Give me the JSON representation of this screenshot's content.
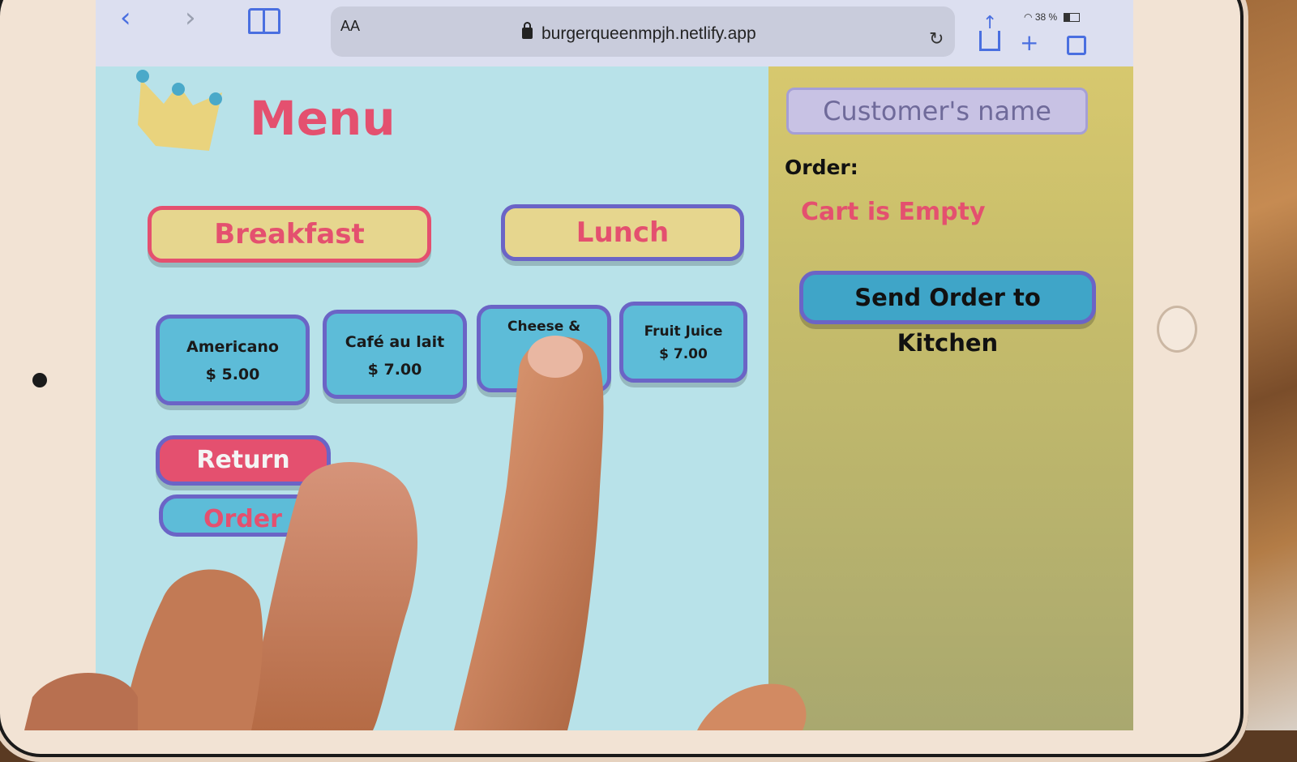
{
  "browser": {
    "text_size_label": "AA",
    "url": "burgerqueenmpjh.netlify.app",
    "battery_text": "38 %"
  },
  "menu": {
    "title": "Menu",
    "tabs": [
      {
        "label": "Breakfast"
      },
      {
        "label": "Lunch"
      }
    ],
    "items": [
      {
        "name": "Americano",
        "price": "$ 5.00"
      },
      {
        "name": "Café au lait",
        "price": "$ 7.00"
      },
      {
        "name": "Cheese &",
        "price": ""
      },
      {
        "name": "Fruit Juice",
        "price": "$ 7.00"
      }
    ],
    "return_label": "Return",
    "orders_label": "Order"
  },
  "order": {
    "customer_placeholder": "Customer's name",
    "order_label": "Order:",
    "cart_status": "Cart is Empty",
    "send_label": "Send Order to Kitchen"
  },
  "colors": {
    "accent_pink": "#e4506f",
    "accent_purple": "#6b64c6",
    "menu_bg": "#b8e2e9",
    "item_bg": "#5dbcd8",
    "tab_bg": "#e6d68e"
  }
}
